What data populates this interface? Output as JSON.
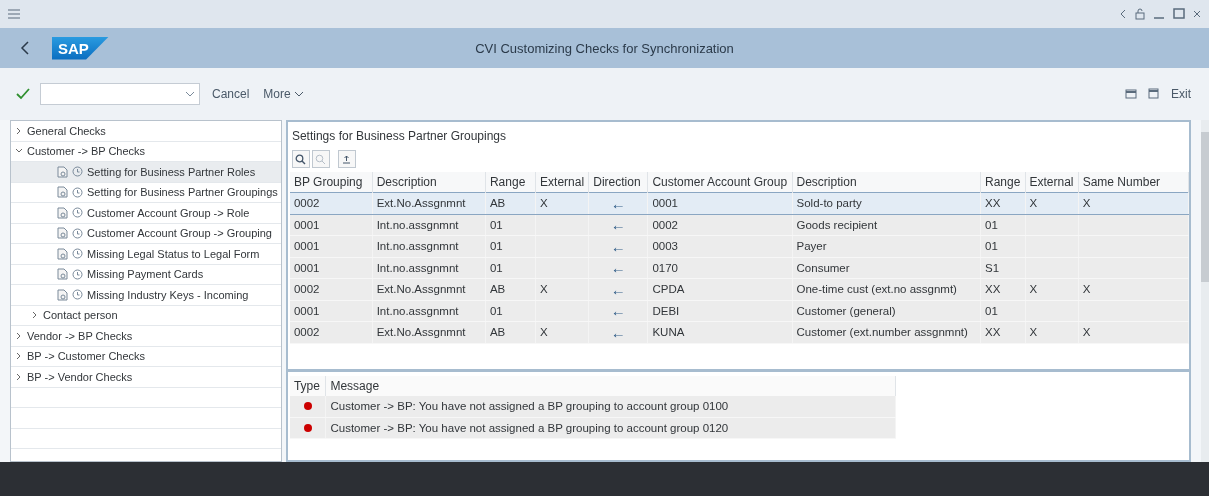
{
  "window": {
    "title": "CVI Customizing Checks for Synchronization",
    "logo": "SAP"
  },
  "toolbar": {
    "buttons": [
      "Cancel",
      "More"
    ],
    "exit": "Exit"
  },
  "tree": [
    {
      "label": "General Checks",
      "expanded": false,
      "selected": false
    },
    {
      "label": "Customer -> BP Checks",
      "expanded": true,
      "selected": false,
      "children": [
        {
          "label": "Setting for Business Partner Roles",
          "kind": "check",
          "selected": true
        },
        {
          "label": "Setting for Business Partner Groupings",
          "kind": "check",
          "selected": false
        },
        {
          "label": "Customer Account Group -> Role",
          "kind": "check",
          "selected": false
        },
        {
          "label": "Customer Account Group -> Grouping",
          "kind": "check",
          "selected": false
        },
        {
          "label": "Missing Legal Status to Legal Form",
          "kind": "check",
          "selected": false
        },
        {
          "label": "Missing Payment Cards",
          "kind": "check",
          "selected": false
        },
        {
          "label": "Missing Industry Keys - Incoming",
          "kind": "check",
          "selected": false
        },
        {
          "label": "Contact person",
          "kind": "folder",
          "expanded": false,
          "selected": false
        }
      ]
    },
    {
      "label": "Vendor -> BP Checks",
      "expanded": false,
      "selected": false
    },
    {
      "label": "BP -> Customer Checks",
      "expanded": false,
      "selected": false
    },
    {
      "label": "BP -> Vendor Checks",
      "expanded": false,
      "selected": false
    }
  ],
  "panel": {
    "title": "Settings for Business Partner Groupings",
    "table": {
      "columns": [
        "BP Grouping",
        "Description",
        "Range",
        "External",
        "Direction",
        "Customer Account Group",
        "Description",
        "Range",
        "External",
        "Same Number"
      ],
      "rows": [
        {
          "selected": true,
          "cells": [
            "0002",
            "Ext.No.Assgnmnt",
            "AB",
            "X",
            "←",
            "0001",
            "Sold-to party",
            "XX",
            "X",
            "X"
          ]
        },
        {
          "selected": false,
          "cells": [
            "0001",
            "Int.no.assgnmnt",
            "01",
            "",
            "←",
            "0002",
            "Goods recipient",
            "01",
            "",
            ""
          ]
        },
        {
          "selected": false,
          "cells": [
            "0001",
            "Int.no.assgnmnt",
            "01",
            "",
            "←",
            "0003",
            "Payer",
            "01",
            "",
            ""
          ]
        },
        {
          "selected": false,
          "cells": [
            "0001",
            "Int.no.assgnmnt",
            "01",
            "",
            "←",
            "0170",
            "Consumer",
            "S1",
            "",
            ""
          ]
        },
        {
          "selected": false,
          "cells": [
            "0002",
            "Ext.No.Assgnmnt",
            "AB",
            "X",
            "←",
            "CPDA",
            "One-time cust (ext.no assgnmt)",
            "XX",
            "X",
            "X"
          ]
        },
        {
          "selected": false,
          "cells": [
            "0001",
            "Int.no.assgnmnt",
            "01",
            "",
            "←",
            "DEBI",
            "Customer (general)",
            "01",
            "",
            ""
          ]
        },
        {
          "selected": false,
          "cells": [
            "0002",
            "Ext.No.Assgnmnt",
            "AB",
            "X",
            "←",
            "KUNA",
            "Customer (ext.number assgnmnt)",
            "XX",
            "X",
            "X"
          ]
        }
      ]
    }
  },
  "messages": {
    "columns": [
      "Type",
      "Message"
    ],
    "rows": [
      {
        "color": "#cc0000",
        "text": "Customer -> BP: You have not assigned a BP grouping to account group 0100"
      },
      {
        "color": "#cc0000",
        "text": "Customer -> BP: You have not assigned a BP grouping to account group 0120"
      }
    ]
  }
}
